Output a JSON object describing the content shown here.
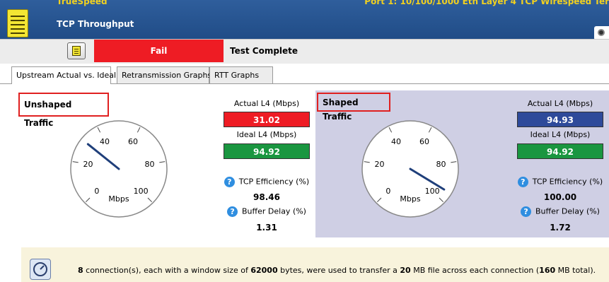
{
  "header": {
    "app_name": "TrueSpeed",
    "port_info": "Port 1: 10/100/1000 Eth Layer 4 TCP Wirespeed Ter",
    "test_name": "TCP Throughput"
  },
  "status": {
    "result": "Fail",
    "message": "Test Complete",
    "result_color": "#ee1c24"
  },
  "tabs": [
    {
      "label": "Upstream Actual vs. Ideal",
      "active": true
    },
    {
      "label": "Retransmission Graphs",
      "active": false
    },
    {
      "label": "RTT Graphs",
      "active": false
    }
  ],
  "unshaped": {
    "title": "Unshaped Traffic",
    "gauge": {
      "ticks": [
        "0",
        "20",
        "40",
        "60",
        "80",
        "100"
      ],
      "unit": "Mbps",
      "value": 31.02
    },
    "actual_label": "Actual L4 (Mbps)",
    "actual_value": "31.02",
    "actual_color": "#ee1c24",
    "ideal_label": "Ideal L4 (Mbps)",
    "ideal_value": "94.92",
    "ideal_color": "#1a9640",
    "efficiency_label": "TCP Efficiency (%)",
    "efficiency_value": "98.46",
    "delay_label": "Buffer Delay (%)",
    "delay_value": "1.31"
  },
  "shaped": {
    "title": "Shaped Traffic",
    "gauge": {
      "ticks": [
        "0",
        "20",
        "40",
        "60",
        "80",
        "100"
      ],
      "unit": "Mbps",
      "value": 94.93
    },
    "actual_label": "Actual L4 (Mbps)",
    "actual_value": "94.93",
    "actual_color": "#2e4a9a",
    "ideal_label": "Ideal L4 (Mbps)",
    "ideal_value": "94.92",
    "ideal_color": "#1a9640",
    "efficiency_label": "TCP Efficiency (%)",
    "efficiency_value": "100.00",
    "delay_label": "Buffer Delay (%)",
    "delay_value": "1.72"
  },
  "footer": {
    "connections": "8",
    "t1": " connection(s), each with a window size of ",
    "window_size": "62000",
    "t2": " bytes, were used to transfer a ",
    "transfer_size": "20",
    "t3": " MB file across each connection (",
    "total": "160",
    "t4": " MB total)."
  },
  "icons": {
    "app": "notepad-icon",
    "camera": "camera-icon",
    "menu": "notepad-menu-icon",
    "help": "help-icon",
    "footer": "speedometer-icon"
  }
}
